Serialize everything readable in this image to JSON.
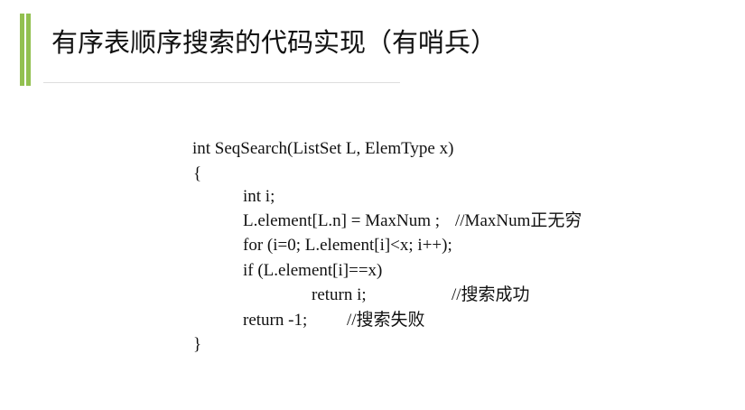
{
  "slide": {
    "title": "有序表顺序搜索的代码实现（有哨兵）",
    "accent_color": "#92c050",
    "code": [
      "int SeqSearch(ListSet L, ElemType x)",
      "{",
      "int i;",
      "L.element[L.n] = MaxNum ;",
      "for (i=0; L.element[i]<x; i++);",
      "if (L.element[i]==x)",
      "return i;",
      "return -1;",
      "}"
    ],
    "comments": {
      "maxnum": "//MaxNum正无穷",
      "success": "//搜索成功",
      "fail": "//搜索失败"
    }
  }
}
